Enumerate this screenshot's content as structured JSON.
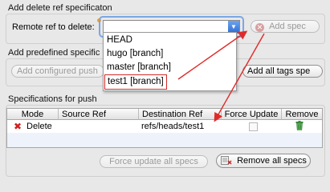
{
  "delete_ref": {
    "title": "Add delete ref specificaton",
    "remote_label": "Remote ref to delete:",
    "remote_value": "",
    "add_spec_label": "Add spec",
    "dropdown_items": [
      "HEAD",
      "hugo [branch]",
      "master [branch]",
      "test1 [branch]"
    ]
  },
  "predefined": {
    "title": "Add predefined specific",
    "configured_label": "Add configured push",
    "all_tags_label": "Add all tags spe"
  },
  "specs": {
    "title": "Specifications for push",
    "columns": [
      "Mode",
      "Source Ref",
      "Destination Ref",
      "Force Update",
      "Remove"
    ],
    "rows": [
      {
        "mode": "Delete",
        "source": "",
        "destination": "refs/heads/test1",
        "force": false
      }
    ],
    "force_update_label": "Force update all specs",
    "remove_all_label": "Remove all specs"
  },
  "colors": {
    "annotation": "#e02a2a",
    "selection_ring": "#7aa7e5"
  },
  "icons": {
    "add_spec": "add-icon",
    "delete_mode": "delete-x-icon",
    "remove_row": "trash-icon",
    "remove_all": "remove-all-icon",
    "combo_arrow": "chevron-down-icon"
  }
}
